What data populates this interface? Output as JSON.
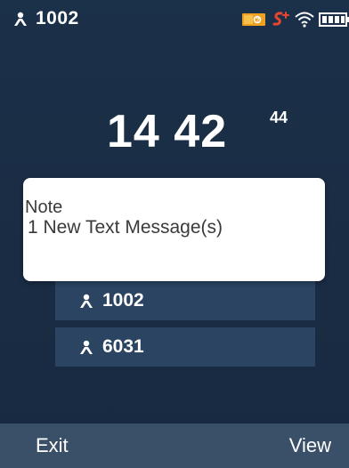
{
  "status_bar": {
    "account": "1002",
    "icons": [
      "voicemail-icon",
      "sms-signal-icon",
      "wifi-icon",
      "battery-icon"
    ]
  },
  "clock": {
    "hours": "14",
    "minutes": "42",
    "seconds": "44"
  },
  "accounts": [
    {
      "label": "1002",
      "icon": "person-icon"
    },
    {
      "label": "6031",
      "icon": "person-icon"
    }
  ],
  "note": {
    "title": "Note",
    "message": "1 New Text Message(s)"
  },
  "softkeys": {
    "left": "Exit",
    "right": "View"
  },
  "colors": {
    "background": "#1a2e47",
    "panel": "#2a4462",
    "softkey_bar": "#3a5069",
    "voicemail_orange": "#f0a020",
    "sms_red": "#e8452f"
  }
}
